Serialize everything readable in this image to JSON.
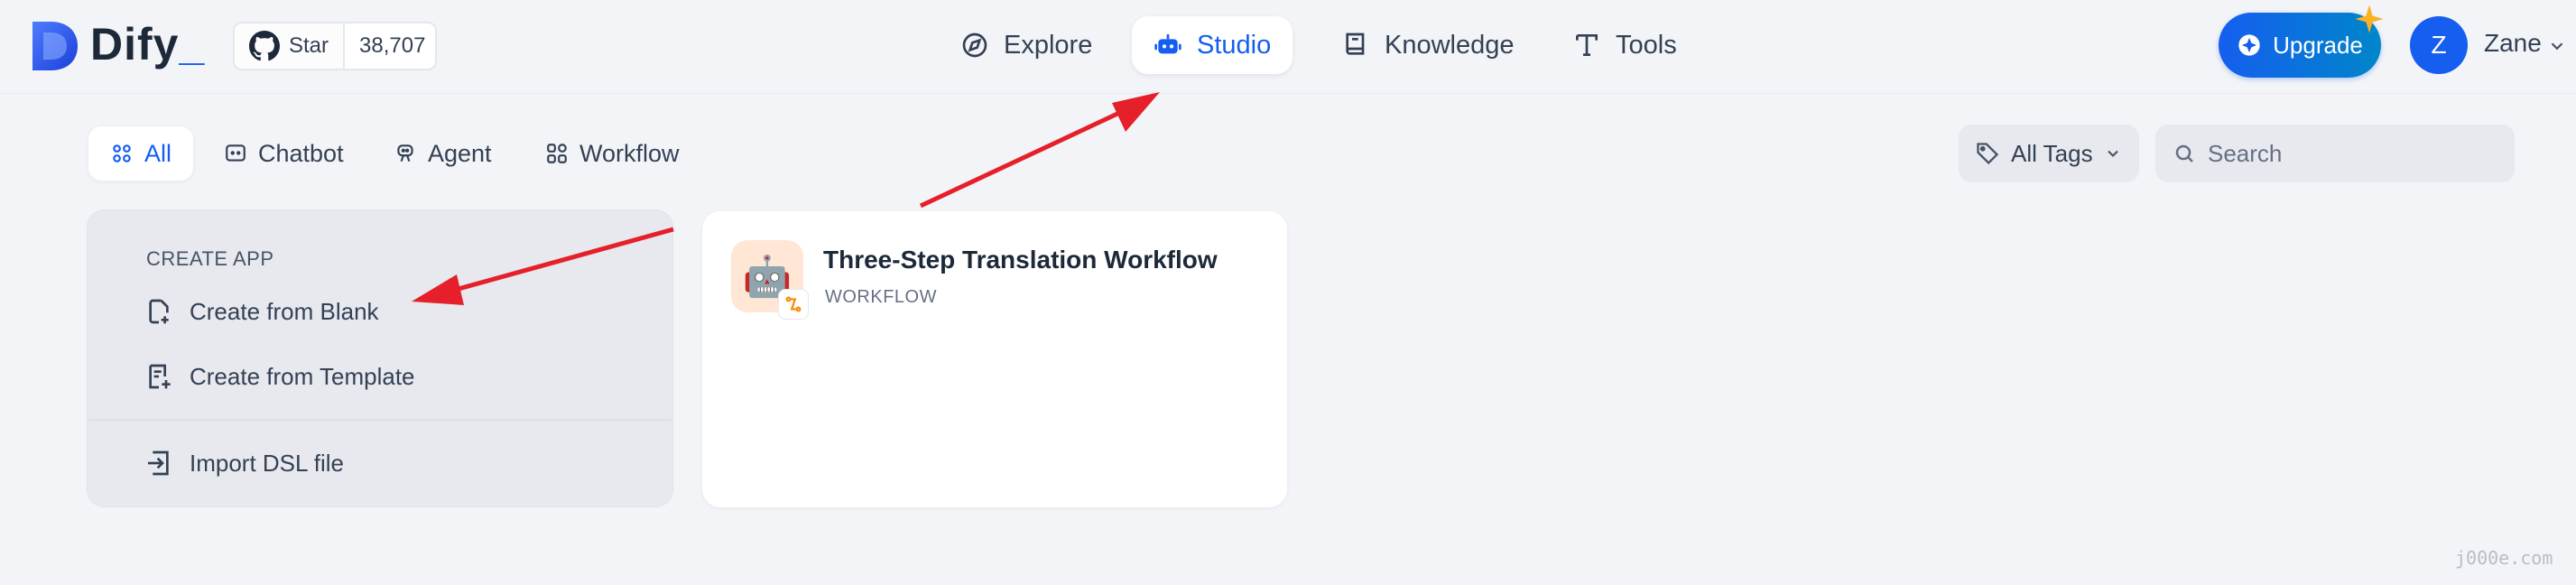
{
  "brand": {
    "name": "Dify",
    "name_suffix": "_"
  },
  "github": {
    "label": "Star",
    "count": "38,707"
  },
  "nav": [
    {
      "label": "Explore",
      "icon": "compass-icon",
      "active": false
    },
    {
      "label": "Studio",
      "icon": "robot-icon",
      "active": true
    },
    {
      "label": "Knowledge",
      "icon": "book-icon",
      "active": false
    },
    {
      "label": "Tools",
      "icon": "tools-icon",
      "active": false
    }
  ],
  "upgrade": {
    "label": "Upgrade"
  },
  "user": {
    "initial": "Z",
    "name": "Zane"
  },
  "filters": {
    "tabs": [
      {
        "label": "All",
        "active": true
      },
      {
        "label": "Chatbot",
        "active": false
      },
      {
        "label": "Agent",
        "active": false
      },
      {
        "label": "Workflow",
        "active": false
      }
    ],
    "tags_label": "All Tags",
    "search_placeholder": "Search"
  },
  "create_app": {
    "heading": "CREATE APP",
    "items": [
      {
        "label": "Create from Blank",
        "icon": "file-plus-icon"
      },
      {
        "label": "Create from Template",
        "icon": "template-icon"
      },
      {
        "label": "Import DSL file",
        "icon": "import-icon"
      }
    ]
  },
  "apps": [
    {
      "title": "Three-Step Translation Workflow",
      "type": "WORKFLOW",
      "icon": "🤖"
    }
  ],
  "watermark": "j000e.com",
  "colors": {
    "accent": "#155eef",
    "annotation": "#e5202a",
    "background": "#f2f4f7"
  }
}
